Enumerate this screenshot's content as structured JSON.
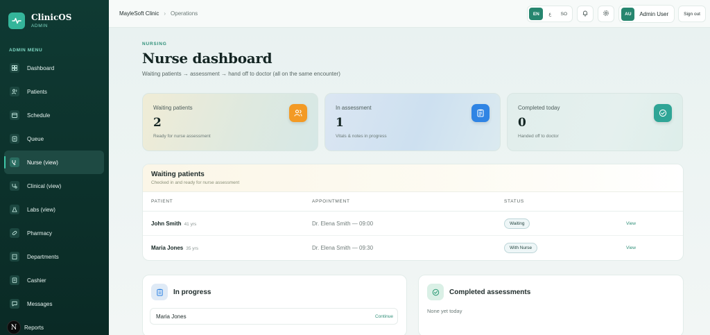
{
  "brand": {
    "name": "ClinicOS",
    "role": "ADMIN"
  },
  "sidebar": {
    "section_title": "ADMIN MENU",
    "items": [
      {
        "label": "Dashboard",
        "icon": "dashboard-icon"
      },
      {
        "label": "Patients",
        "icon": "users-icon"
      },
      {
        "label": "Schedule",
        "icon": "calendar-icon"
      },
      {
        "label": "Queue",
        "icon": "clipboard-icon"
      },
      {
        "label": "Nurse (view)",
        "icon": "stethoscope-icon",
        "active": true
      },
      {
        "label": "Clinical (view)",
        "icon": "stethoscope-icon"
      },
      {
        "label": "Labs (view)",
        "icon": "flask-icon"
      },
      {
        "label": "Pharmacy",
        "icon": "pill-icon"
      },
      {
        "label": "Departments",
        "icon": "building-icon"
      },
      {
        "label": "Cashier",
        "icon": "receipt-icon"
      },
      {
        "label": "Messages",
        "icon": "message-icon"
      },
      {
        "label": "Reports",
        "icon": "chart-icon"
      }
    ],
    "avatar_letter": "N"
  },
  "topbar": {
    "breadcrumb": [
      "MayleSoft Clinic",
      "Operations"
    ],
    "languages": [
      "EN",
      "ع",
      "SO"
    ],
    "active_language": "EN",
    "user_initials": "AU",
    "user_name": "Admin User",
    "signout_label": "Sign out"
  },
  "page": {
    "eyebrow": "NURSING",
    "title": "Nurse dashboard",
    "subtitle": "Waiting patients → assessment → hand off to doctor (all on the same encounter)"
  },
  "stats": [
    {
      "label": "Waiting patients",
      "value": "2",
      "note": "Ready for nurse assessment",
      "icon": "users-icon",
      "color": "#f39a24"
    },
    {
      "label": "In assessment",
      "value": "1",
      "note": "Vitals & notes in progress",
      "icon": "clipboard-icon",
      "color": "#2f84e4"
    },
    {
      "label": "Completed today",
      "value": "0",
      "note": "Handed off to doctor",
      "icon": "check-circle-icon",
      "color": "#2fa596"
    }
  ],
  "waiting": {
    "title": "Waiting patients",
    "subtitle": "Checked in and ready for nurse assessment",
    "columns": [
      "PATIENT",
      "APPOINTMENT",
      "STATUS"
    ],
    "rows": [
      {
        "name": "John Smith",
        "age": "41 yrs",
        "appointment": "Dr. Elena Smith — 09:00",
        "status": "Waiting",
        "action": "View"
      },
      {
        "name": "Maria Jones",
        "age": "35 yrs",
        "appointment": "Dr. Elena Smith — 09:30",
        "status": "With Nurse",
        "action": "View"
      }
    ]
  },
  "in_progress": {
    "title": "In progress",
    "items": [
      {
        "name": "Maria Jones",
        "action": "Continue"
      }
    ]
  },
  "completed": {
    "title": "Completed assessments",
    "empty": "None yet today"
  }
}
